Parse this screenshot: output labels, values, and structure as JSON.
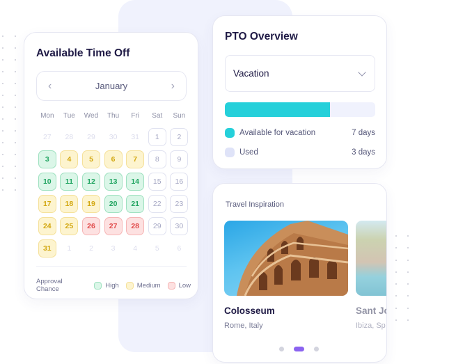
{
  "calendar": {
    "title": "Available Time Off",
    "month": "January",
    "prev_icon": "‹",
    "next_icon": "›",
    "weekdays": [
      "Mon",
      "Tue",
      "Wed",
      "Thu",
      "Fri",
      "Sat",
      "Sun"
    ],
    "days": [
      {
        "d": "27",
        "s": "outside"
      },
      {
        "d": "28",
        "s": "outside"
      },
      {
        "d": "29",
        "s": "outside"
      },
      {
        "d": "30",
        "s": "outside"
      },
      {
        "d": "31",
        "s": "outside"
      },
      {
        "d": "1",
        "s": "free"
      },
      {
        "d": "2",
        "s": "free"
      },
      {
        "d": "3",
        "s": "high"
      },
      {
        "d": "4",
        "s": "medium"
      },
      {
        "d": "5",
        "s": "medium"
      },
      {
        "d": "6",
        "s": "medium"
      },
      {
        "d": "7",
        "s": "medium"
      },
      {
        "d": "8",
        "s": "free"
      },
      {
        "d": "9",
        "s": "free"
      },
      {
        "d": "10",
        "s": "high"
      },
      {
        "d": "11",
        "s": "high"
      },
      {
        "d": "12",
        "s": "high"
      },
      {
        "d": "13",
        "s": "high"
      },
      {
        "d": "14",
        "s": "high"
      },
      {
        "d": "15",
        "s": "free"
      },
      {
        "d": "16",
        "s": "free"
      },
      {
        "d": "17",
        "s": "medium"
      },
      {
        "d": "18",
        "s": "medium"
      },
      {
        "d": "19",
        "s": "medium"
      },
      {
        "d": "20",
        "s": "high"
      },
      {
        "d": "21",
        "s": "high"
      },
      {
        "d": "22",
        "s": "free"
      },
      {
        "d": "23",
        "s": "free"
      },
      {
        "d": "24",
        "s": "medium"
      },
      {
        "d": "25",
        "s": "medium"
      },
      {
        "d": "26",
        "s": "low"
      },
      {
        "d": "27",
        "s": "low"
      },
      {
        "d": "28",
        "s": "low"
      },
      {
        "d": "29",
        "s": "free"
      },
      {
        "d": "30",
        "s": "free"
      },
      {
        "d": "31",
        "s": "medium"
      },
      {
        "d": "1",
        "s": "outside"
      },
      {
        "d": "2",
        "s": "outside"
      },
      {
        "d": "3",
        "s": "outside"
      },
      {
        "d": "4",
        "s": "outside"
      },
      {
        "d": "5",
        "s": "outside"
      },
      {
        "d": "6",
        "s": "outside"
      }
    ],
    "legend": {
      "label": "Approval Chance",
      "high": "High",
      "medium": "Medium",
      "low": "Low"
    },
    "colors": {
      "high": "#dbf6e8",
      "medium": "#fdf4cf",
      "low": "#fde1e1"
    }
  },
  "pto": {
    "title": "PTO Overview",
    "selected_type": "Vacation",
    "progress_available_fraction": 0.7,
    "rows": [
      {
        "label": "Available for vacation",
        "value": "7 days",
        "color": "#25d0da"
      },
      {
        "label": "Used",
        "value": "3 days",
        "color": "#dfe3f8"
      }
    ]
  },
  "travel": {
    "title": "Travel Inspiration",
    "slides": [
      {
        "name": "Colosseum",
        "location": "Rome, Italy",
        "image": "colosseum-photo"
      },
      {
        "name": "Sant Jo",
        "location": "Ibiza, Sp",
        "image": "ibiza-coast-photo"
      }
    ],
    "pager_count": 3,
    "pager_active": 1,
    "accent": "#8b63f0"
  }
}
